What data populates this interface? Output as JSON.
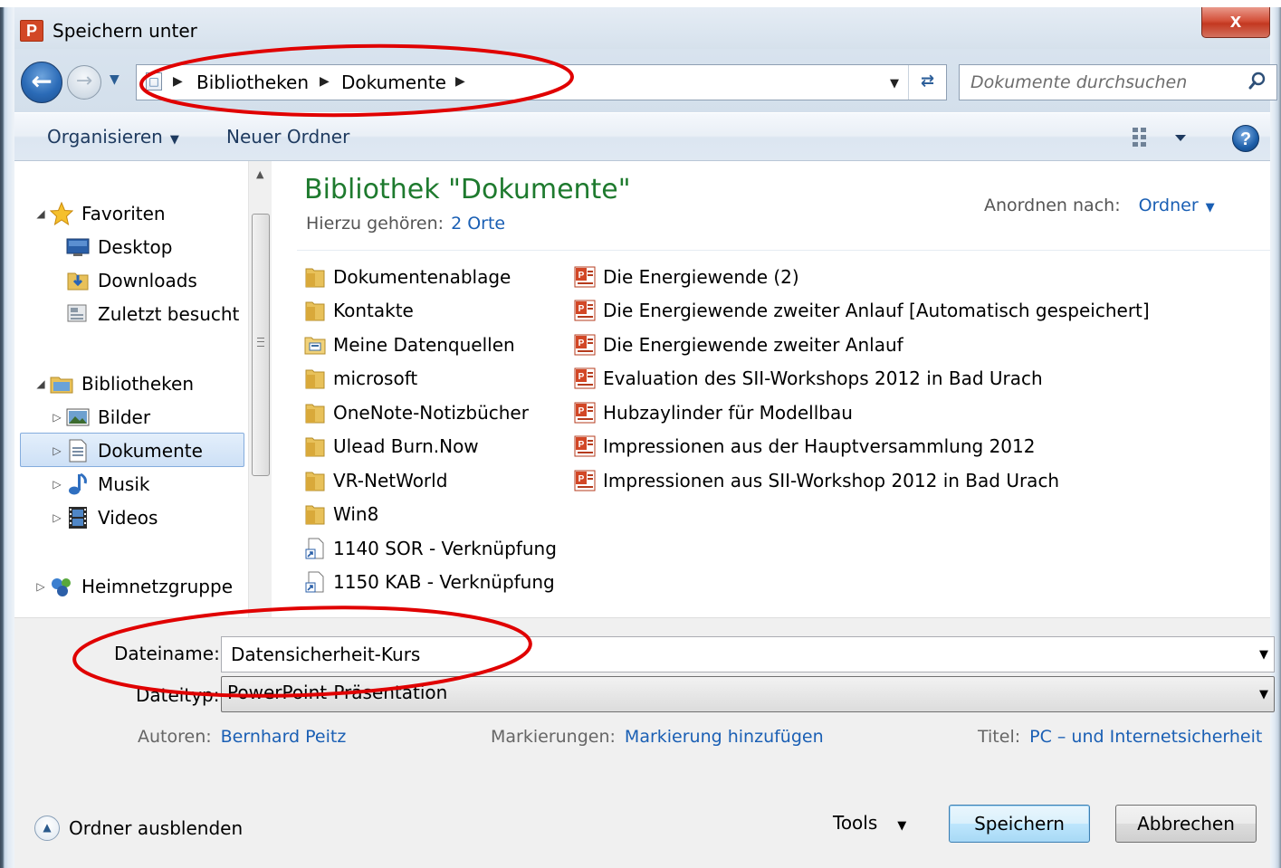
{
  "window": {
    "title": "Speichern unter",
    "close_symbol": "x",
    "app_icon_letter": "P"
  },
  "address_bar": {
    "crumbs": [
      "Bibliotheken",
      "Dokumente"
    ],
    "search_placeholder": "Dokumente durchsuchen"
  },
  "toolbar": {
    "organize_label": "Organisieren",
    "new_folder_label": "Neuer Ordner",
    "help_symbol": "?"
  },
  "nav_pane": {
    "favorites": {
      "label": "Favoriten",
      "items": [
        "Desktop",
        "Downloads",
        "Zuletzt besucht"
      ]
    },
    "libraries": {
      "label": "Bibliotheken",
      "items": [
        "Bilder",
        "Dokumente",
        "Musik",
        "Videos"
      ],
      "selected": "Dokumente"
    },
    "homegroup": {
      "label": "Heimnetzgruppe"
    }
  },
  "content": {
    "title": "Bibliothek \"Dokumente\"",
    "includes_label": "Hierzu gehören:",
    "includes_link": "2 Orte",
    "arrange_label": "Anordnen nach:",
    "arrange_value": "Ordner",
    "folders": [
      {
        "name": "Dokumentenablage",
        "icon": "folder-icon"
      },
      {
        "name": "Kontakte",
        "icon": "folder-icon"
      },
      {
        "name": "Meine Datenquellen",
        "icon": "data-sources-folder-icon"
      },
      {
        "name": "microsoft",
        "icon": "folder-icon"
      },
      {
        "name": "OneNote-Notizbücher",
        "icon": "folder-icon"
      },
      {
        "name": "Ulead Burn.Now",
        "icon": "folder-icon"
      },
      {
        "name": "VR-NetWorld",
        "icon": "folder-icon"
      },
      {
        "name": "Win8",
        "icon": "folder-icon"
      },
      {
        "name": "1140 SOR - Verknüpfung",
        "icon": "shortcut-icon"
      },
      {
        "name": "1150 KAB - Verknüpfung",
        "icon": "shortcut-icon"
      }
    ],
    "files": [
      "Die Energiewende (2)",
      "Die Energiewende zweiter Anlauf [Automatisch gespeichert]",
      "Die Energiewende zweiter Anlauf",
      "Evaluation des SII-Workshops 2012 in Bad Urach",
      "Hubzaylinder für Modellbau",
      "Impressionen aus der Hauptversammlung 2012",
      "Impressionen aus SII-Workshop 2012 in Bad Urach"
    ]
  },
  "save_form": {
    "filename_label": "Dateiname:",
    "filename_value": "Datensicherheit-Kurs",
    "filetype_label": "Dateityp:",
    "filetype_value": "PowerPoint-Präsentation",
    "authors_label": "Autoren:",
    "authors_value": "Bernhard  Peitz",
    "tags_label": "Markierungen:",
    "tags_value": "Markierung hinzufügen",
    "title_label": "Titel:",
    "title_value": "PC – und Internetsicherheit"
  },
  "footer": {
    "hide_folders_label": "Ordner ausblenden",
    "tools_label": "Tools",
    "save_label": "Speichern",
    "cancel_label": "Abbrechen"
  },
  "colors": {
    "library_title": "#1e7a2e",
    "link": "#1a5fb4",
    "annotation": "#e00000",
    "close_button": "#c33820"
  }
}
